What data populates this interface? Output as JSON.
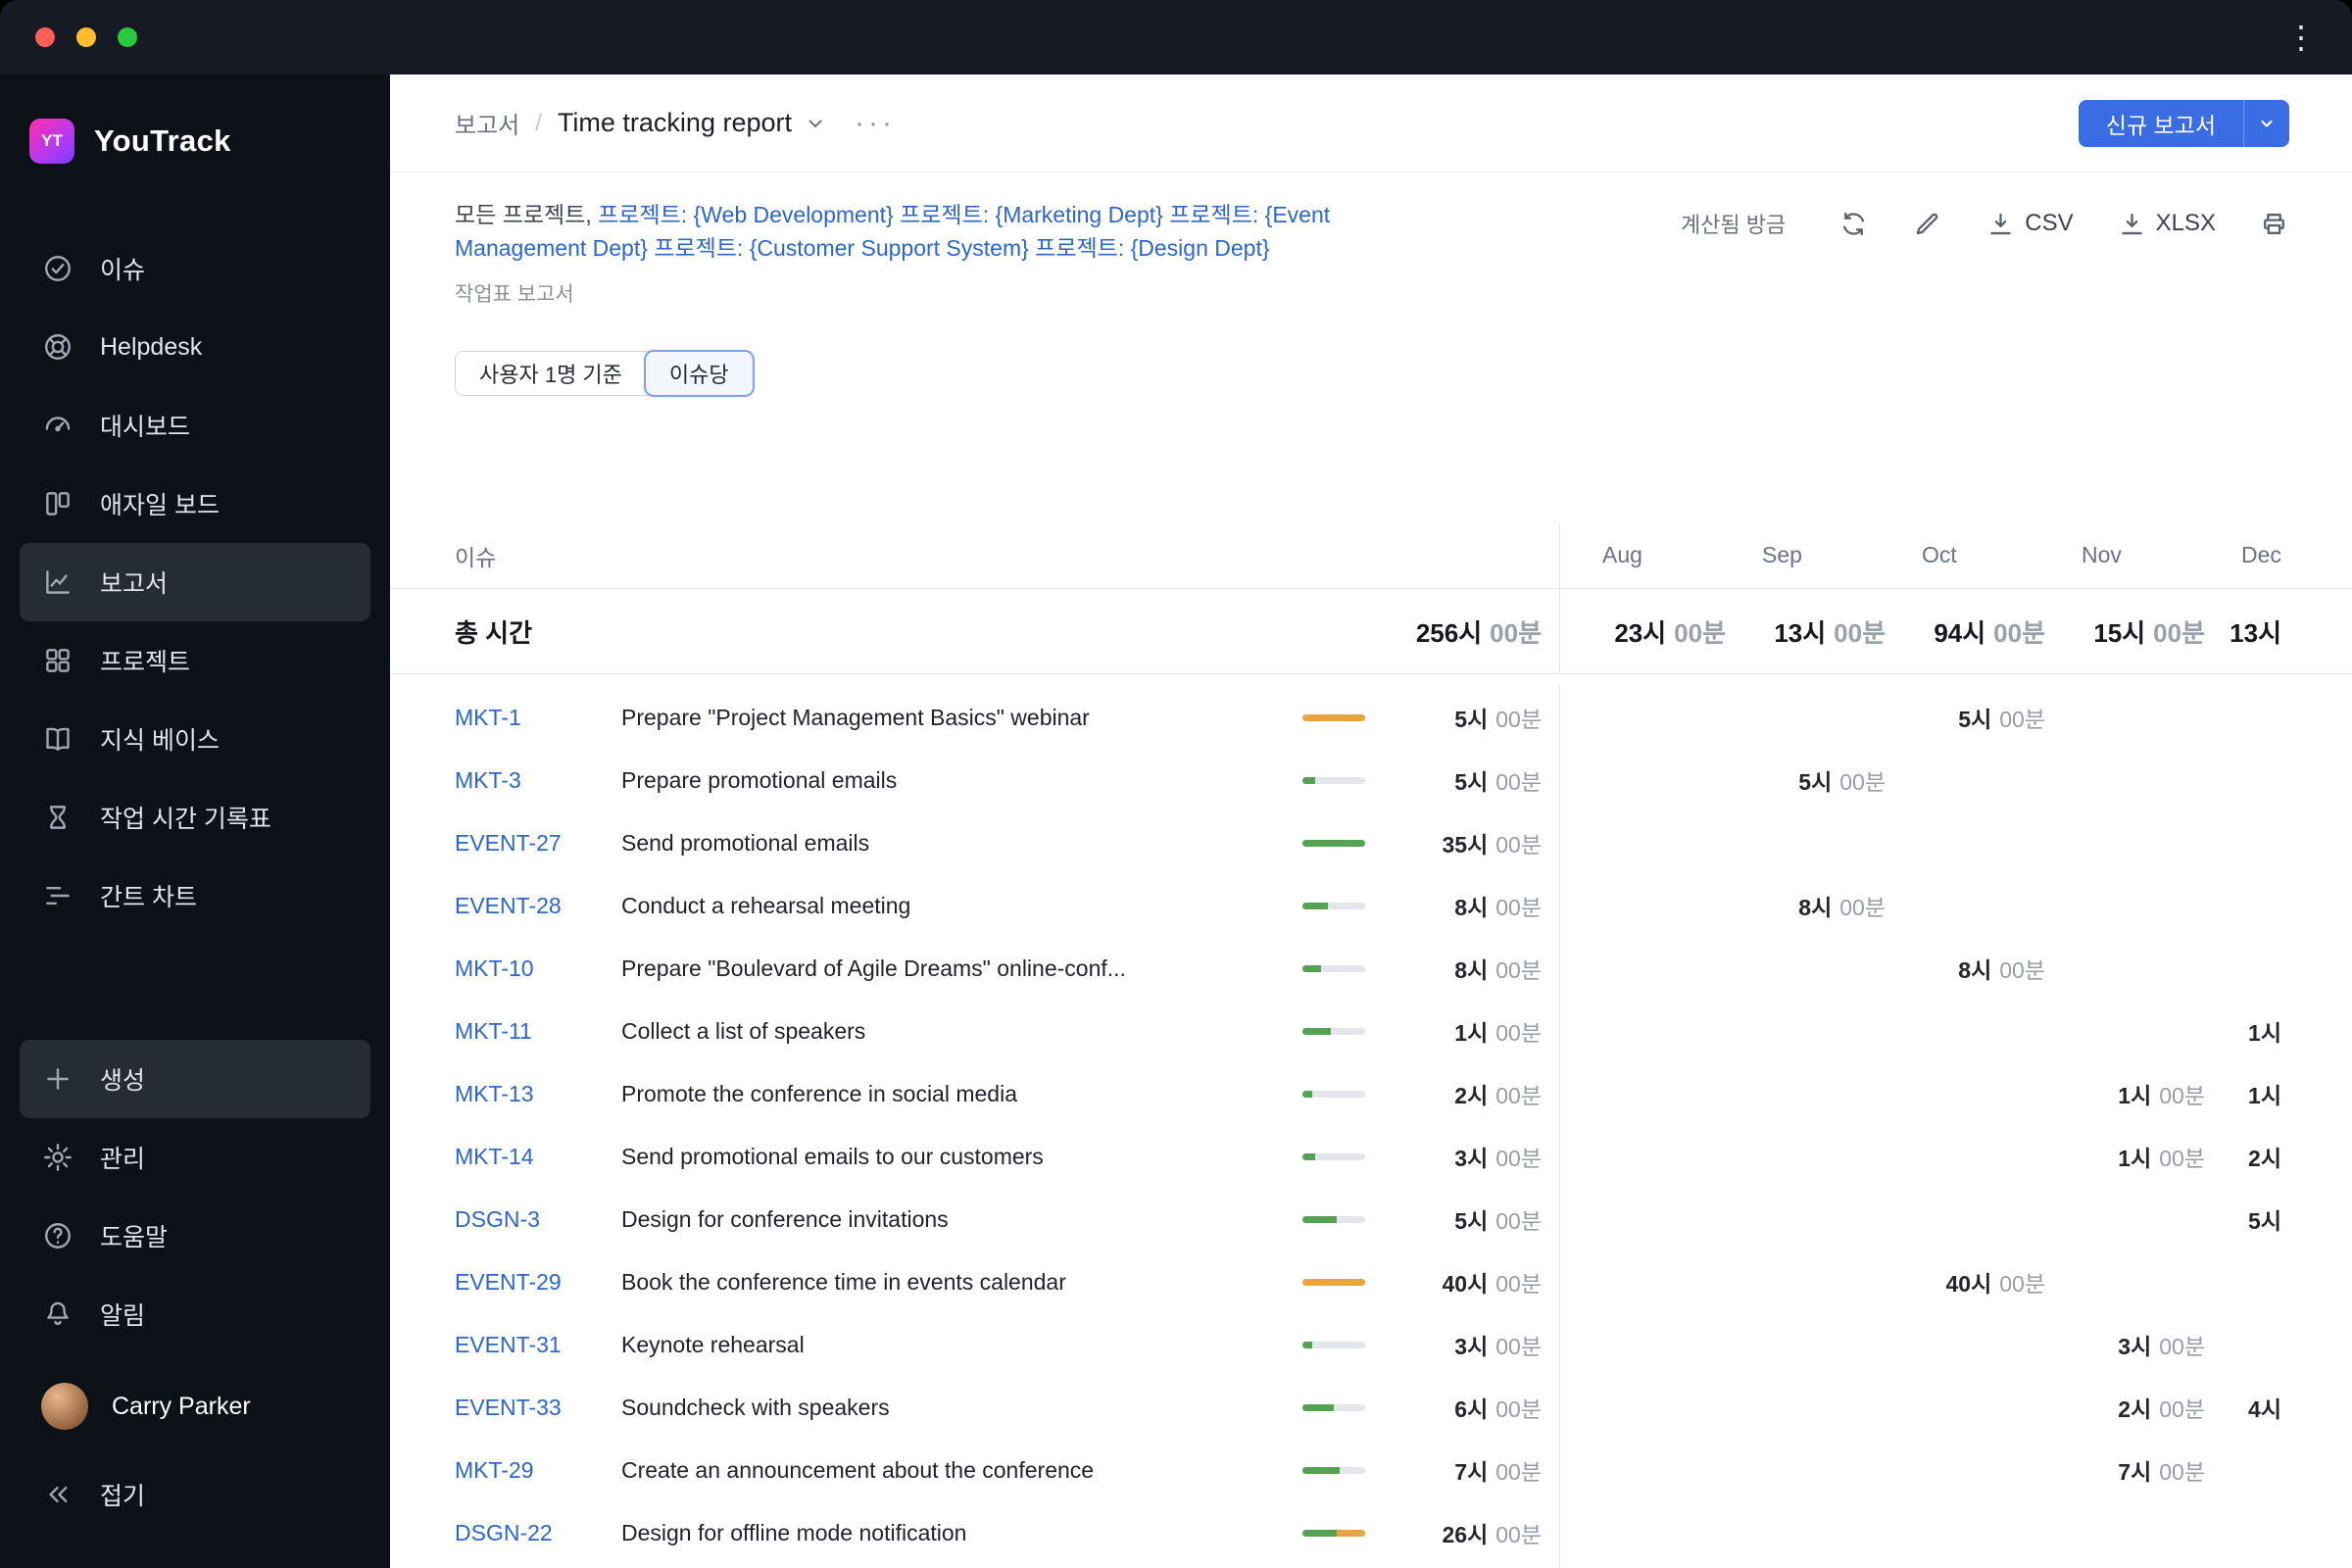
{
  "icons": {
    "titlebar_menu": "⋮",
    "breadcrumb_more": "···"
  },
  "colors": {
    "accent_blue": "#3a6ce4",
    "link_blue": "#2e66c8",
    "bar_green": "#55a254",
    "bar_orange": "#e8a43e",
    "traffic_close": "#ff5f57",
    "traffic_minimize": "#febc2e",
    "traffic_zoom": "#28c840"
  },
  "sidebar": {
    "logo_badge": "YT",
    "logo_text": "YouTrack",
    "items": [
      {
        "label": "이슈",
        "icon": "check-circle-icon"
      },
      {
        "label": "Helpdesk",
        "icon": "helpdesk-icon"
      },
      {
        "label": "대시보드",
        "icon": "dashboard-icon"
      },
      {
        "label": "애자일 보드",
        "icon": "agile-board-icon"
      },
      {
        "label": "보고서",
        "icon": "reports-icon",
        "active": true
      },
      {
        "label": "프로젝트",
        "icon": "projects-icon"
      },
      {
        "label": "지식 베이스",
        "icon": "knowledge-base-icon"
      },
      {
        "label": "작업 시간 기록표",
        "icon": "timesheet-icon"
      },
      {
        "label": "간트 차트",
        "icon": "gantt-icon"
      }
    ],
    "footer_items": [
      {
        "label": "생성",
        "icon": "plus-icon",
        "highlight": true
      },
      {
        "label": "관리",
        "icon": "gear-icon"
      },
      {
        "label": "도움말",
        "icon": "help-icon"
      },
      {
        "label": "알림",
        "icon": "bell-icon"
      }
    ],
    "user": {
      "name": "Carry Parker"
    },
    "collapse_label": "접기"
  },
  "header": {
    "breadcrumb_root": "보고서",
    "breadcrumb_separator": "/",
    "title": "Time tracking report",
    "new_report_button": "신규 보고서"
  },
  "toolbar": {
    "filter_prefix": "모든 프로젝트, ",
    "filter_links": "프로젝트: {Web Development} 프로젝트: {Marketing Dept} 프로젝트: {Event Management Dept} 프로젝트: {Customer Support System} 프로젝트: {Design Dept}",
    "calculated_label": "계산됨 방금",
    "csv_label": "CSV",
    "xlsx_label": "XLSX",
    "subtitle": "작업표 보고서"
  },
  "view_toggle": {
    "options": [
      {
        "label": "사용자 1명 기준",
        "active": false
      },
      {
        "label": "이슈당",
        "active": true
      }
    ]
  },
  "table": {
    "issue_header": "이슈",
    "months": [
      "Aug",
      "Sep",
      "Oct",
      "Nov",
      "Dec"
    ],
    "total": {
      "label": "총 시간",
      "hours": "256시",
      "minutes": "00분",
      "month_values": [
        {
          "h": "23시",
          "m": "00분"
        },
        {
          "h": "13시",
          "m": "00분"
        },
        {
          "h": "94시",
          "m": "00분"
        },
        {
          "h": "15시",
          "m": "00분"
        },
        {
          "h": "13시",
          "m": ""
        }
      ]
    },
    "rows": [
      {
        "id": "MKT-1",
        "summary": "Prepare \"Project Management Basics\" webinar",
        "hours": "5시",
        "minutes": "00분",
        "bar": [
          {
            "c": "orange",
            "w": 100
          }
        ],
        "months": [
          null,
          null,
          {
            "h": "5시",
            "m": "00분"
          },
          null,
          null
        ]
      },
      {
        "id": "MKT-3",
        "summary": "Prepare promotional emails",
        "hours": "5시",
        "minutes": "00분",
        "bar": [
          {
            "c": "green",
            "w": 20
          },
          {
            "c": "track",
            "w": 80
          }
        ],
        "months": [
          null,
          {
            "h": "5시",
            "m": "00분"
          },
          null,
          null,
          null
        ]
      },
      {
        "id": "EVENT-27",
        "summary": "Send promotional emails",
        "hours": "35시",
        "minutes": "00분",
        "bar": [
          {
            "c": "green",
            "w": 100
          }
        ],
        "months": [
          null,
          null,
          null,
          null,
          null
        ]
      },
      {
        "id": "EVENT-28",
        "summary": "Conduct a rehearsal meeting",
        "hours": "8시",
        "minutes": "00분",
        "bar": [
          {
            "c": "green",
            "w": 40
          },
          {
            "c": "track",
            "w": 60
          }
        ],
        "months": [
          null,
          {
            "h": "8시",
            "m": "00분"
          },
          null,
          null,
          null
        ]
      },
      {
        "id": "MKT-10",
        "summary": "Prepare \"Boulevard of Agile Dreams\" online-conf...",
        "hours": "8시",
        "minutes": "00분",
        "bar": [
          {
            "c": "green",
            "w": 30
          },
          {
            "c": "track",
            "w": 70
          }
        ],
        "months": [
          null,
          null,
          {
            "h": "8시",
            "m": "00분"
          },
          null,
          null
        ]
      },
      {
        "id": "MKT-11",
        "summary": "Collect a list of speakers",
        "hours": "1시",
        "minutes": "00분",
        "bar": [
          {
            "c": "green",
            "w": 45
          },
          {
            "c": "track",
            "w": 55
          }
        ],
        "months": [
          null,
          null,
          null,
          null,
          {
            "h": "1시",
            "m": ""
          }
        ]
      },
      {
        "id": "MKT-13",
        "summary": "Promote the conference in social media",
        "hours": "2시",
        "minutes": "00분",
        "bar": [
          {
            "c": "green",
            "w": 15
          },
          {
            "c": "track",
            "w": 85
          }
        ],
        "months": [
          null,
          null,
          null,
          {
            "h": "1시",
            "m": "00분"
          },
          {
            "h": "1시",
            "m": ""
          }
        ]
      },
      {
        "id": "MKT-14",
        "summary": "Send promotional emails to our customers",
        "hours": "3시",
        "minutes": "00분",
        "bar": [
          {
            "c": "green",
            "w": 20
          },
          {
            "c": "track",
            "w": 80
          }
        ],
        "months": [
          null,
          null,
          null,
          {
            "h": "1시",
            "m": "00분"
          },
          {
            "h": "2시",
            "m": ""
          }
        ]
      },
      {
        "id": "DSGN-3",
        "summary": "Design for conference invitations",
        "hours": "5시",
        "minutes": "00분",
        "bar": [
          {
            "c": "green",
            "w": 55
          },
          {
            "c": "track",
            "w": 45
          }
        ],
        "months": [
          null,
          null,
          null,
          null,
          {
            "h": "5시",
            "m": ""
          }
        ]
      },
      {
        "id": "EVENT-29",
        "summary": "Book the conference time in events calendar",
        "hours": "40시",
        "minutes": "00분",
        "bar": [
          {
            "c": "orange",
            "w": 100
          }
        ],
        "months": [
          null,
          null,
          {
            "h": "40시",
            "m": "00분"
          },
          null,
          null
        ]
      },
      {
        "id": "EVENT-31",
        "summary": "Keynote rehearsal",
        "hours": "3시",
        "minutes": "00분",
        "bar": [
          {
            "c": "green",
            "w": 15
          },
          {
            "c": "track",
            "w": 85
          }
        ],
        "months": [
          null,
          null,
          null,
          {
            "h": "3시",
            "m": "00분"
          },
          null
        ]
      },
      {
        "id": "EVENT-33",
        "summary": "Soundcheck with speakers",
        "hours": "6시",
        "minutes": "00분",
        "bar": [
          {
            "c": "green",
            "w": 50
          },
          {
            "c": "track",
            "w": 50
          }
        ],
        "months": [
          null,
          null,
          null,
          {
            "h": "2시",
            "m": "00분"
          },
          {
            "h": "4시",
            "m": ""
          }
        ]
      },
      {
        "id": "MKT-29",
        "summary": "Create an announcement about the conference",
        "hours": "7시",
        "minutes": "00분",
        "bar": [
          {
            "c": "green",
            "w": 60
          },
          {
            "c": "track",
            "w": 40
          }
        ],
        "months": [
          null,
          null,
          null,
          {
            "h": "7시",
            "m": "00분"
          },
          null
        ]
      },
      {
        "id": "DSGN-22",
        "summary": "Design for offline mode notification",
        "hours": "26시",
        "minutes": "00분",
        "bar": [
          {
            "c": "green",
            "w": 55
          },
          {
            "c": "orange",
            "w": 45
          }
        ],
        "months": [
          null,
          null,
          null,
          null,
          null
        ]
      }
    ]
  }
}
